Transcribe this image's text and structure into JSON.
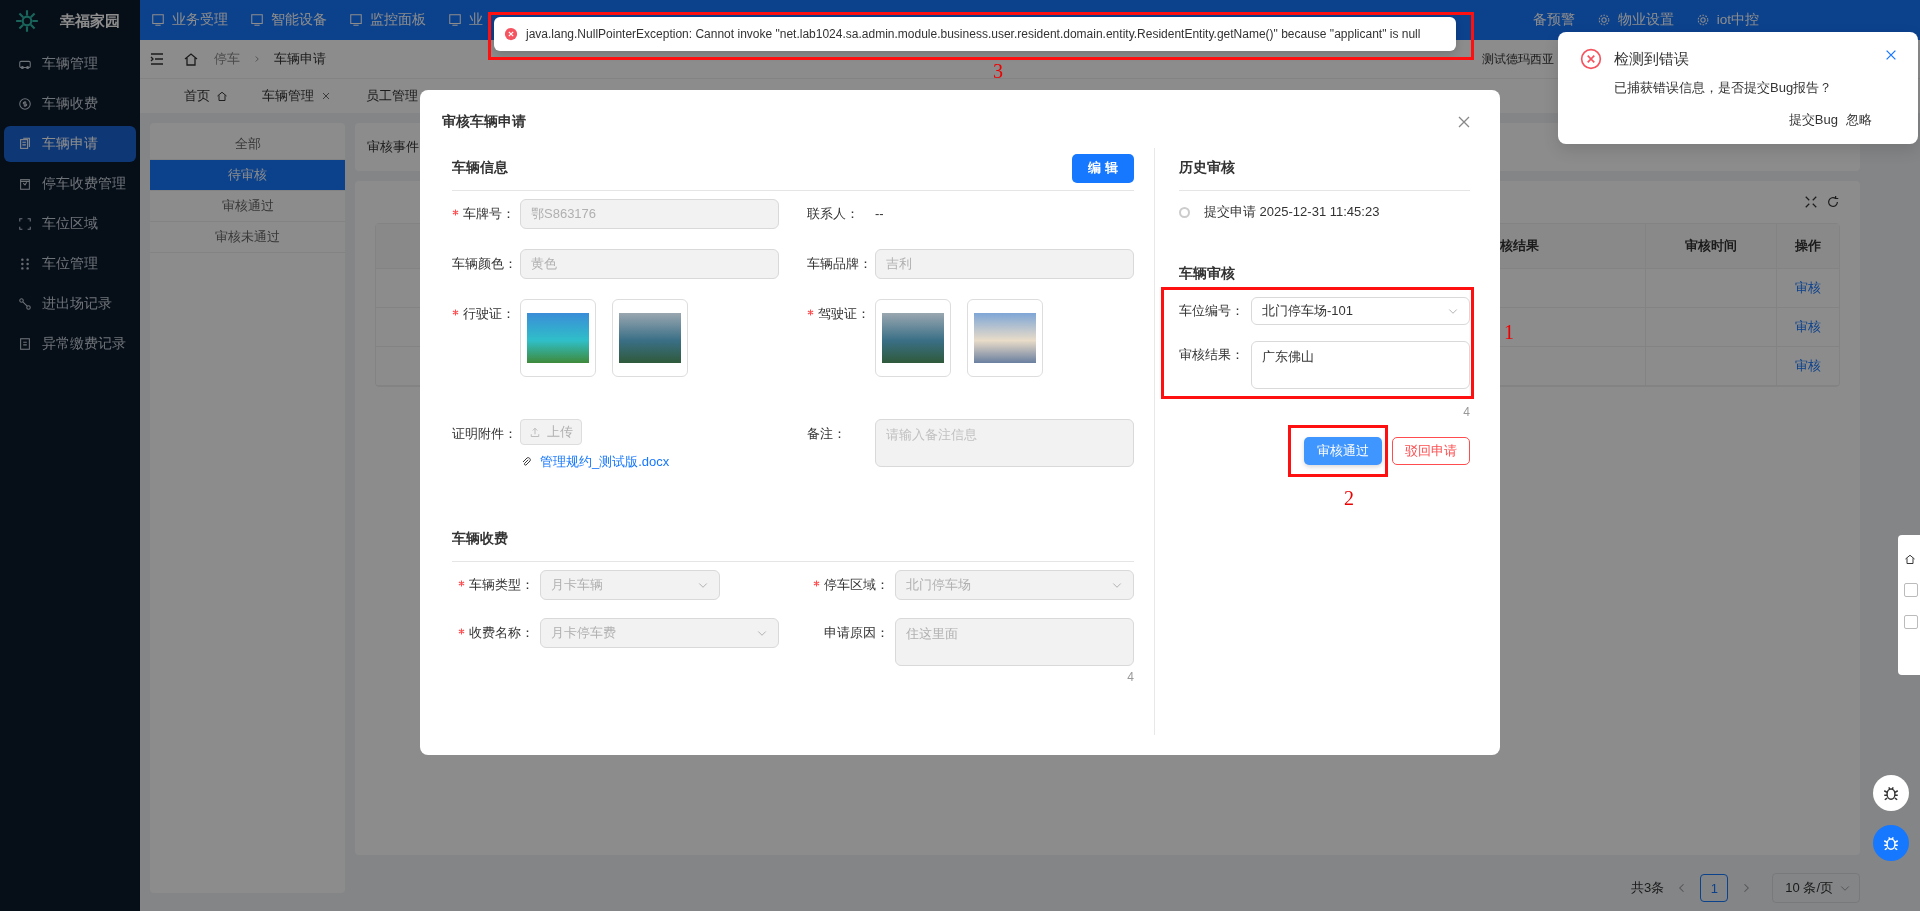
{
  "sidebar": {
    "logo_text": "幸福家园",
    "items": [
      {
        "label": "车辆管理",
        "selected": false
      },
      {
        "label": "车辆收费",
        "selected": false
      },
      {
        "label": "车辆申请",
        "selected": true
      },
      {
        "label": "停车收费管理",
        "selected": false
      },
      {
        "label": "车位区域",
        "selected": false
      },
      {
        "label": "车位管理",
        "selected": false
      },
      {
        "label": "进出场记录",
        "selected": false
      },
      {
        "label": "异常缴费记录",
        "selected": false
      }
    ]
  },
  "top_nav": {
    "left_items": [
      "业务受理",
      "智能设备",
      "监控面板",
      "业"
    ],
    "right_items": [
      "备预警",
      "物业设置",
      "iot中控"
    ]
  },
  "breadcrumb": {
    "items": [
      "停车",
      "车辆申请"
    ],
    "user": "测试德玛西亚"
  },
  "tabs": [
    {
      "label": "首页",
      "kind": "home",
      "selected": false
    },
    {
      "label": "车辆管理",
      "kind": "closable",
      "selected": false
    },
    {
      "label": "员工管理",
      "kind": "plain",
      "selected": false
    }
  ],
  "status_filter": [
    {
      "label": "全部",
      "selected": false
    },
    {
      "label": "待审核",
      "selected": true
    },
    {
      "label": "审核通过",
      "selected": false
    },
    {
      "label": "审核未通过",
      "selected": false
    }
  ],
  "search_label": "审核事件",
  "table": {
    "columns": [
      "核结果",
      "审核时间",
      "操作"
    ],
    "rows": [
      {
        "action": "审核"
      },
      {
        "action": "审核"
      },
      {
        "action": "审核"
      }
    ]
  },
  "pagination": {
    "total": "共3条",
    "pages": [
      {
        "label": "1",
        "selected": true
      }
    ],
    "page_size": "10 条/页"
  },
  "modal": {
    "title": "审核车辆申请",
    "vehicle_info": {
      "title": "车辆信息",
      "edit_button": "编 辑",
      "fields": [
        {
          "label": "车牌号：",
          "required": true,
          "kind": "input",
          "value": "鄂S863176",
          "disabled": true
        },
        {
          "label": "联系人：",
          "required": false,
          "kind": "text",
          "value": "--"
        },
        {
          "label": "车辆颜色：",
          "required": false,
          "kind": "input",
          "value": "黄色",
          "disabled": true
        },
        {
          "label": "车辆品牌：",
          "required": false,
          "kind": "input",
          "value": "吉利",
          "disabled": true
        },
        {
          "label": "行驶证：",
          "required": true,
          "kind": "images"
        },
        {
          "label": "驾驶证：",
          "required": true,
          "kind": "images"
        },
        {
          "label": "证明附件：",
          "required": false,
          "kind": "upload",
          "button": "上传",
          "file": "管理规约_测试版.docx",
          "disabled": true
        },
        {
          "label": "备注：",
          "required": false,
          "kind": "textarea",
          "placeholder": "请输入备注信息",
          "disabled": true
        }
      ]
    },
    "fee": {
      "title": "车辆收费",
      "fields": [
        {
          "label": "车辆类型：",
          "required": true,
          "kind": "select",
          "value": "月卡车辆",
          "disabled": true
        },
        {
          "label": "停车区域：",
          "required": true,
          "kind": "select",
          "value": "北门停车场",
          "disabled": true
        },
        {
          "label": "收费名称：",
          "required": true,
          "kind": "select",
          "value": "月卡停车费",
          "disabled": true
        },
        {
          "label": "申请原因：",
          "required": false,
          "kind": "textarea",
          "value": "住这里面",
          "count": "4",
          "disabled": true
        }
      ]
    },
    "history": {
      "title": "历史审核",
      "entries": [
        "提交申请 2025-12-31 11:45:23"
      ]
    },
    "review": {
      "title": "车辆审核",
      "annotation": "1",
      "space_label": "车位编号：",
      "space_value": "北门停车场-101",
      "result_label": "审核结果：",
      "result_value": "广东佛山",
      "count": "4",
      "approve_button": "审核通过",
      "approve_annotation": "2",
      "reject_button": "驳回申请"
    }
  },
  "floating_panel": {
    "checkboxes": [
      {
        "checked": false
      },
      {
        "checked": false
      }
    ]
  },
  "error_toast": {
    "message": "java.lang.NullPointerException: Cannot invoke \"net.lab1024.sa.admin.module.business.user.resident.domain.entity.ResidentEntity.getName()\" because \"applicant\" is null",
    "annotation": "3"
  },
  "notification": {
    "title": "检测到错误",
    "message": "已捕获错误信息，是否提交Bug报告？",
    "actions": [
      "提交Bug",
      "忽略"
    ]
  }
}
